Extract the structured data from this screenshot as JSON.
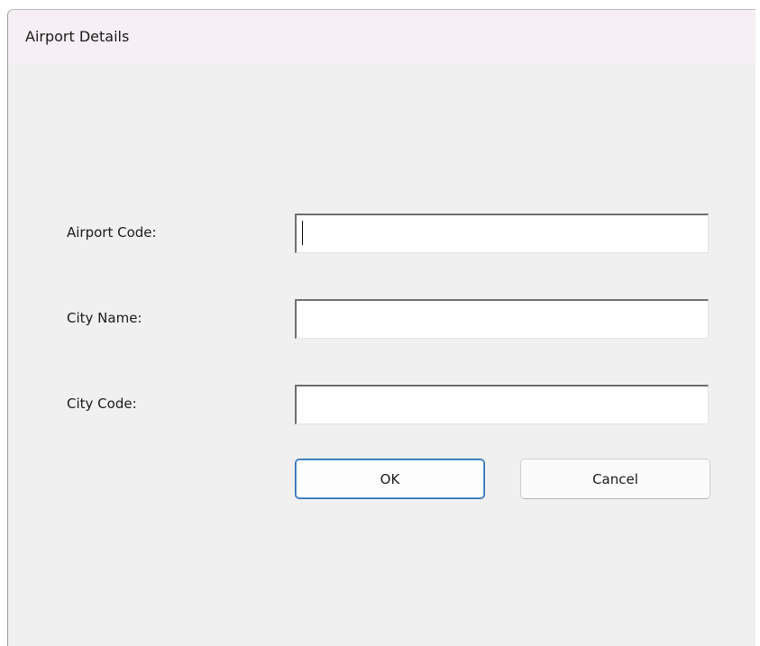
{
  "dialog": {
    "title": "Airport Details"
  },
  "form": {
    "airport_code": {
      "label": "Airport Code:",
      "value": "",
      "placeholder": ""
    },
    "city_name": {
      "label": "City Name:",
      "value": "",
      "placeholder": ""
    },
    "city_code": {
      "label": "City Code:",
      "value": "",
      "placeholder": ""
    }
  },
  "buttons": {
    "ok_label": "OK",
    "cancel_label": "Cancel"
  },
  "colors": {
    "window_bg": "#f0f0f0",
    "titlebar_bg": "#f6eff4",
    "default_button_border": "#2b6cb0"
  }
}
